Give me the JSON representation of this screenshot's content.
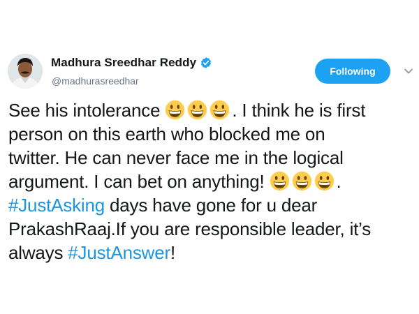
{
  "user": {
    "display_name": "Madhura Sreedhar Reddy",
    "handle": "@madhurasreedhar",
    "verified": true,
    "avatar_icon": "user-avatar-photo"
  },
  "actions": {
    "follow_label": "Following",
    "menu_icon": "chevron-down-icon"
  },
  "colors": {
    "link": "#1b95e0",
    "follow_button": "#1da1f2",
    "emoji_face": "#ffcc4d",
    "secondary_text": "#657786"
  },
  "tweet": {
    "emoji_icon": "grinning-face-emoji",
    "lines": {
      "l1_before": "See his intolerance",
      "l1_after": ". I think he is first",
      "l2": "person on this earth who blocked me on",
      "l3": "twitter. He can never face me in the logical",
      "l4_before": "argument. I can bet on anything!",
      "l4_after": ".",
      "l5_hashtag": "#JustAsking",
      "l5_after": " days have gone for u dear",
      "l6": "PrakashRaaj.If you are responsible leader, it’s",
      "l7_before": "always ",
      "l7_hashtag": "#JustAnswer",
      "l7_after": "!"
    }
  }
}
